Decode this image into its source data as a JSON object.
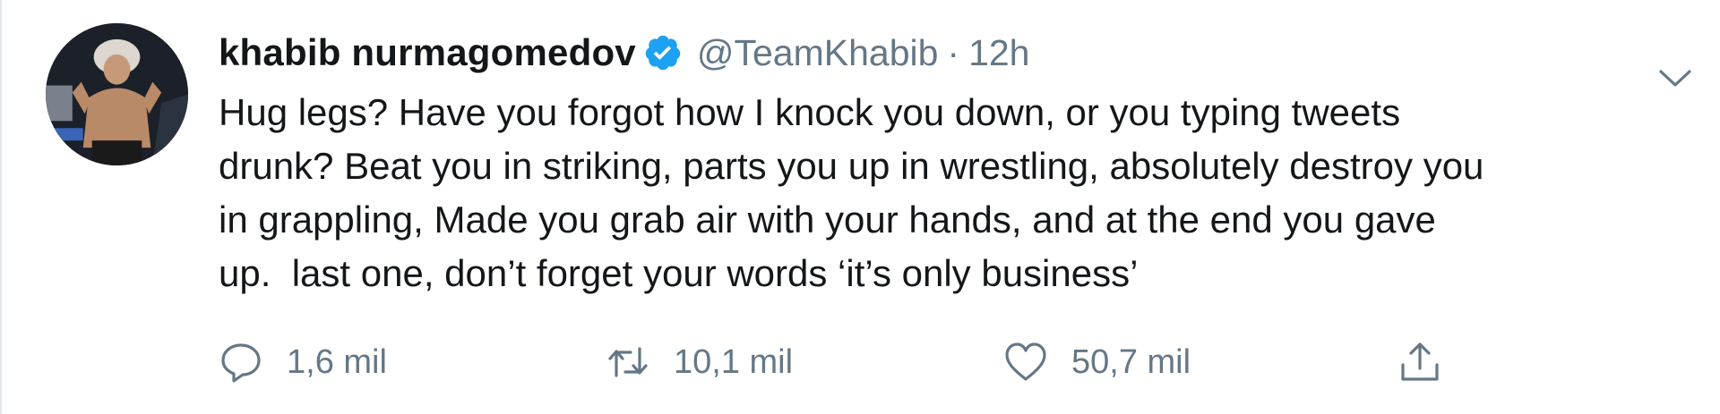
{
  "tweet": {
    "display_name": "khabib nurmagomedov",
    "handle": "@TeamKhabib",
    "separator": "·",
    "timestamp": "12h",
    "verified": true,
    "text": "Hug legs? Have you forgot how I knock you down, or you typing tweets\ndrunk? Beat you in striking, parts you up in wrestling, absolutely destroy you\nin grappling, Made you grab air with your hands, and at the end you gave\nup.  last one, don’t forget your words ‘it’s only business’",
    "actions": {
      "reply_count": "1,6 mil",
      "retweet_count": "10,1 mil",
      "like_count": "50,7 mil"
    }
  },
  "colors": {
    "verified_blue": "#1da1f2",
    "secondary_text": "#657786",
    "primary_text": "#14171a"
  },
  "icons": {
    "avatar": "profile-photo",
    "verified": "verified-badge-icon",
    "caret": "chevron-down-icon",
    "reply": "reply-bubble-icon",
    "retweet": "retweet-icon",
    "like": "heart-icon",
    "share": "share-upload-icon"
  }
}
